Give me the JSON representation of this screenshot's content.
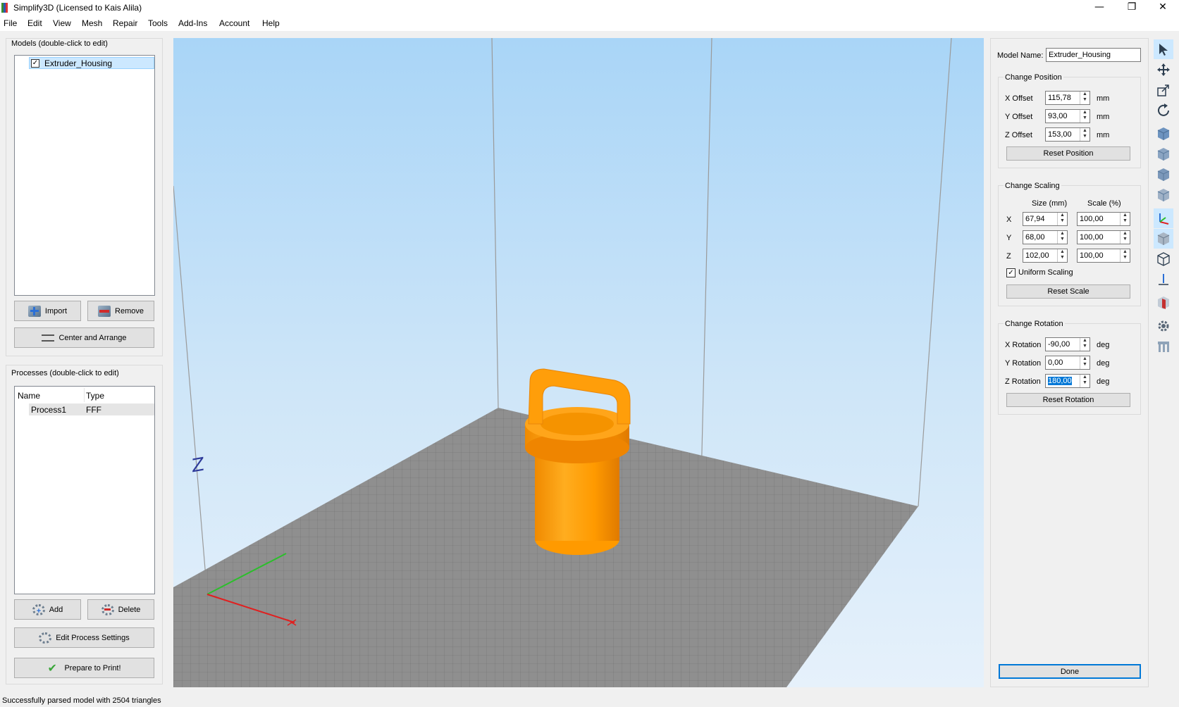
{
  "window": {
    "title": "Simplify3D (Licensed to Kais Alila)",
    "minimize": "—",
    "restore": "❐",
    "close": "✕"
  },
  "menu": [
    "File",
    "Edit",
    "View",
    "Mesh",
    "Repair",
    "Tools",
    "Add-Ins",
    "Account",
    "Help"
  ],
  "models": {
    "label": "Models (double-click to edit)",
    "items": [
      {
        "name": "Extruder_Housing",
        "checked": true
      }
    ],
    "import_label": "Import",
    "remove_label": "Remove",
    "center_label": "Center and Arrange"
  },
  "processes": {
    "label": "Processes (double-click to edit)",
    "col_name": "Name",
    "col_type": "Type",
    "rows": [
      {
        "name": "Process1",
        "type": "FFF"
      }
    ],
    "add_label": "Add",
    "delete_label": "Delete",
    "edit_label": "Edit Process Settings",
    "prepare_label": "Prepare to Print!"
  },
  "viewport": {
    "axis_label": "Z",
    "model_color": "#ff9a00",
    "bed_color": "#8f8f8f"
  },
  "properties": {
    "model_name_label": "Model Name:",
    "model_name": "Extruder_Housing",
    "position": {
      "title": "Change Position",
      "x_label": "X Offset",
      "x": "115,78",
      "y_label": "Y Offset",
      "y": "93,00",
      "z_label": "Z Offset",
      "z": "153,00",
      "unit": "mm",
      "reset": "Reset Position"
    },
    "scaling": {
      "title": "Change Scaling",
      "size_header": "Size (mm)",
      "scale_header": "Scale (%)",
      "rows": [
        {
          "axis": "X",
          "size": "67,94",
          "scale": "100,00"
        },
        {
          "axis": "Y",
          "size": "68,00",
          "scale": "100,00"
        },
        {
          "axis": "Z",
          "size": "102,00",
          "scale": "100,00"
        }
      ],
      "uniform_label": "Uniform Scaling",
      "uniform_checked": true,
      "reset": "Reset Scale"
    },
    "rotation": {
      "title": "Change Rotation",
      "x_label": "X Rotation",
      "x": "-90,00",
      "y_label": "Y Rotation",
      "y": "0,00",
      "z_label": "Z Rotation",
      "z": "180,00",
      "unit": "deg",
      "reset": "Reset Rotation"
    },
    "done_label": "Done"
  },
  "toolbar_icons": [
    "select-icon",
    "move-icon",
    "scale-icon",
    "rotate-icon",
    "view-cube-icon",
    "view-cube-front-icon",
    "view-cube-side-icon",
    "view-cube-top-icon",
    "axes-icon",
    "solid-view-icon",
    "wireframe-icon",
    "bottom-axis-icon",
    "cross-section-icon",
    "settings-gear-icon",
    "supports-icon"
  ],
  "status": "Successfully parsed model with 2504 triangles"
}
